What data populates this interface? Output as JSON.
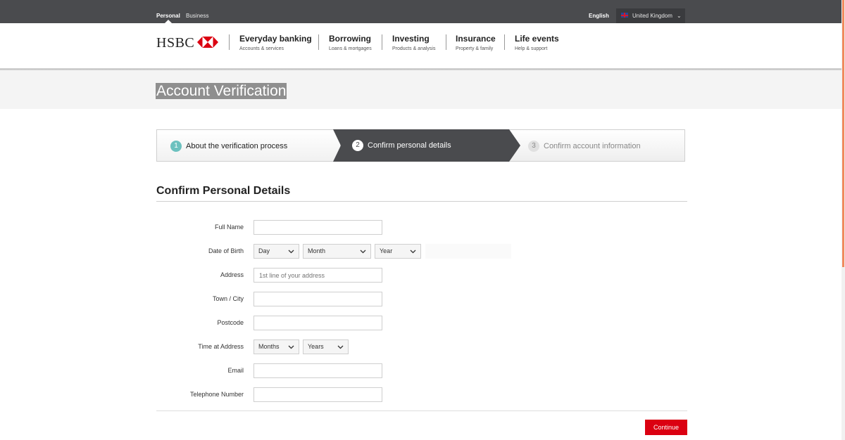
{
  "topbar": {
    "segments": [
      {
        "label": "Personal",
        "active": true
      },
      {
        "label": "Business",
        "active": false
      }
    ],
    "language": "English",
    "country": "United Kingdom"
  },
  "header": {
    "logo_text": "HSBC",
    "nav": [
      {
        "title": "Everyday banking",
        "subtitle": "Accounts & services"
      },
      {
        "title": "Borrowing",
        "subtitle": "Loans & mortgages"
      },
      {
        "title": "Investing",
        "subtitle": "Products & analysis"
      },
      {
        "title": "Insurance",
        "subtitle": "Property & family"
      },
      {
        "title": "Life events",
        "subtitle": "Help & support"
      }
    ]
  },
  "page_title": "Account Verification",
  "stepper": {
    "steps": [
      {
        "number": "1",
        "label": "About the verification process",
        "state": "completed"
      },
      {
        "number": "2",
        "label": "Confirm personal details",
        "state": "active"
      },
      {
        "number": "3",
        "label": "Confirm account information",
        "state": "upcoming"
      }
    ]
  },
  "form": {
    "heading": "Confirm Personal Details",
    "fields": {
      "full_name": {
        "label": "Full Name",
        "value": "",
        "placeholder": ""
      },
      "dob": {
        "label": "Date of Birth",
        "day": "Day",
        "month": "Month",
        "year": "Year"
      },
      "address": {
        "label": "Address",
        "value": "",
        "placeholder": "1st line of your address"
      },
      "town": {
        "label": "Town / City",
        "value": "",
        "placeholder": ""
      },
      "postcode": {
        "label": "Postcode",
        "value": "",
        "placeholder": ""
      },
      "time_at_address": {
        "label": "Time at Address",
        "months": "Months",
        "years": "Years"
      },
      "email": {
        "label": "Email",
        "value": "",
        "placeholder": ""
      },
      "telephone": {
        "label": "Telephone Number",
        "value": "",
        "placeholder": ""
      }
    },
    "continue_label": "Continue"
  },
  "colors": {
    "brand_red": "#db0011",
    "topbar_bg": "#4a4b4e",
    "active_step_bg": "#4a4b4e",
    "completed_step_badge": "#6cc1bf"
  }
}
